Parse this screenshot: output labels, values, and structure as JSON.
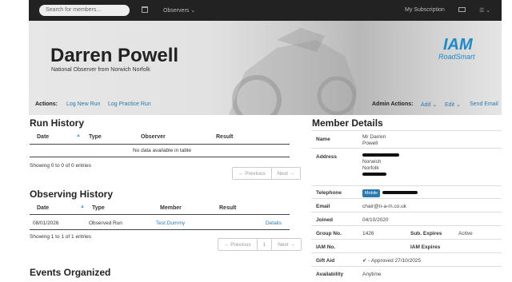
{
  "topbar": {
    "search_placeholder": "Search for members...",
    "observers_label": "Observers",
    "subscription_label": "My Subscription"
  },
  "hero": {
    "name": "Darren Powell",
    "subtitle": "National Observer from Norwich Norfolk",
    "logo_top": "IAM",
    "logo_bottom": "RoadSmart"
  },
  "actions": {
    "label": "Actions:",
    "log_new_run": "Log New Run",
    "log_practice_run": "Log Practice Run",
    "admin_label": "Admin Actions:",
    "add": "Add",
    "edit": "Edit",
    "send_email": "Send Email"
  },
  "run_history": {
    "title": "Run History",
    "columns": [
      "Date",
      "Type",
      "Observer",
      "Result"
    ],
    "empty": "No data available in table",
    "info": "Showing 0 to 0 of 0 entries",
    "prev": "← Previous",
    "next": "Next →"
  },
  "observing_history": {
    "title": "Observing History",
    "columns": [
      "Date",
      "Type",
      "Member",
      "Result"
    ],
    "rows": [
      {
        "date": "08/01/2026",
        "type": "Observed Run",
        "member": "Test Dummy",
        "action": "Details"
      }
    ],
    "info": "Showing 1 to 1 of 1 entries",
    "prev": "← Previous",
    "page": "1",
    "next": "Next →"
  },
  "events": {
    "title": "Events Organized"
  },
  "member_details": {
    "title": "Member Details",
    "name_label": "Name",
    "name_line1": "Mr Darren",
    "name_line2": "Powell",
    "address_label": "Address",
    "address_city": "Norwich",
    "address_county": "Norfolk",
    "telephone_label": "Telephone",
    "mobile_badge": "Mobile",
    "email_label": "Email",
    "email": "chair@n-a-m.co.uk",
    "joined_label": "Joined",
    "joined": "04/10/2020",
    "group_label": "Group No.",
    "group": "1426",
    "sub_expires_label": "Sub. Expires",
    "sub_status": "Active",
    "iam_no_label": "IAM No.",
    "iam_expires_label": "IAM Expires",
    "gift_aid_label": "Gift Aid",
    "gift_aid": "- Approved 27/10/2025",
    "availability_label": "Availability",
    "availability": "Anytime"
  }
}
